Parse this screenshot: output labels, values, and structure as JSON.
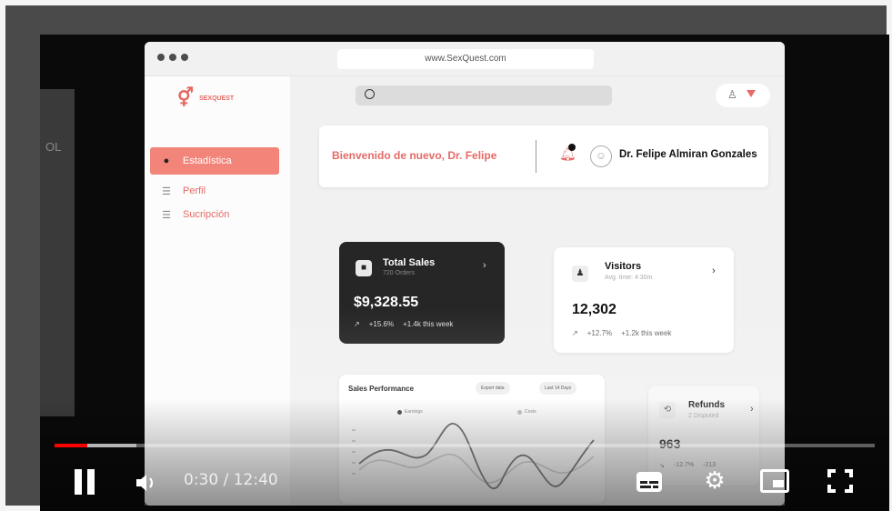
{
  "background_page": {
    "edge_text": "OL"
  },
  "browser": {
    "url": "www.SexQuest.com"
  },
  "sidebar": {
    "logo_text": "SEXQUEST",
    "items": [
      {
        "label": "Estadística",
        "icon": "user-circle-icon",
        "active": true
      },
      {
        "label": "Perfil",
        "icon": "list-icon",
        "active": false
      },
      {
        "label": "Sucripción",
        "icon": "list-icon",
        "active": false
      }
    ]
  },
  "header": {
    "welcome": "Bienvenido de nuevo, Dr. Felipe",
    "user_name": "Dr. Felipe Almiran Gonzales"
  },
  "cards": {
    "total_sales": {
      "title": "Total Sales",
      "subtitle": "720 Orders",
      "value": "$9,328.55",
      "change": "+15.6%",
      "weekly": "+1.4k this week"
    },
    "visitors": {
      "title": "Visitors",
      "subtitle": "Avg. time: 4:30m",
      "value": "12,302",
      "change": "+12.7%",
      "weekly": "+1.2k this week"
    },
    "refunds": {
      "title": "Refunds",
      "subtitle": "2 Disputed",
      "value": "963",
      "change": "-12.7%",
      "weekly": "-213"
    }
  },
  "sales_performance": {
    "title": "Sales Performance",
    "export_label": "Export data",
    "range_label": "Last 14 Days",
    "legend": [
      "Earnings",
      "Costs"
    ]
  },
  "player": {
    "time": "0:30 / 12:40",
    "progress": 0.04,
    "buffered": 0.1,
    "colors": {
      "played": "#ff0000",
      "accent": "#e56a66"
    }
  }
}
